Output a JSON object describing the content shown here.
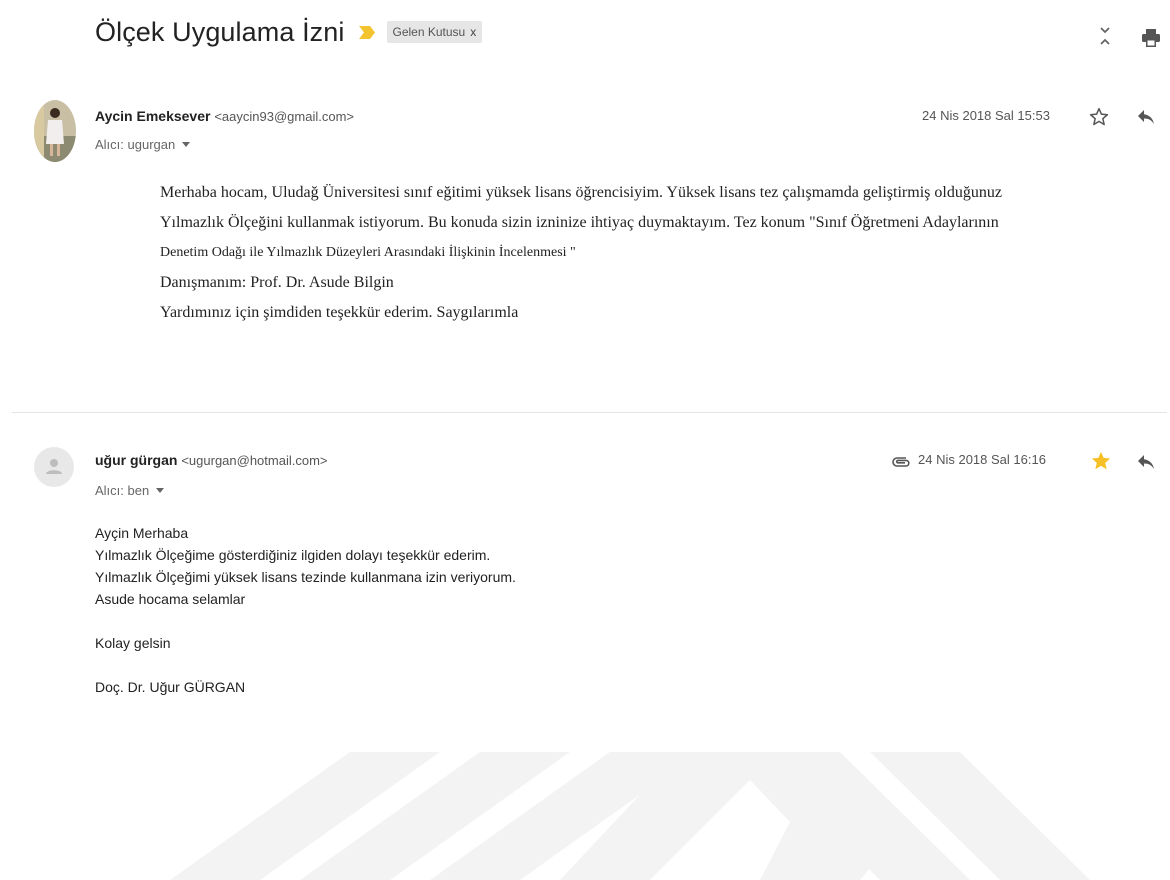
{
  "thread": {
    "subject": "Ölçek Uygulama İzni",
    "label": "Gelen Kutusu",
    "label_close": "x"
  },
  "messages": [
    {
      "sender_name": "Aycin Emeksever",
      "sender_email": "<aaycin93@gmail.com>",
      "to": "Alıcı: ugurgan",
      "date": "24 Nis 2018 Sal 15:53",
      "starred": false,
      "has_attachment": false,
      "body": [
        "Merhaba hocam, Uludağ Üniversitesi sınıf eğitimi yüksek lisans öğrencisiyim. Yüksek lisans tez çalışmamda geliştirmiş olduğunuz",
        "Yılmazlık Ölçeğini  kullanmak istiyorum. Bu konuda sizin izninize ihtiyaç duymaktayım. Tez konum \"Sınıf Öğretmeni Adaylarının",
        "Denetim Odağı ile Yılmazlık Düzeyleri Arasındaki İlişkinin İncelenmesi \"",
        "Danışmanım: Prof. Dr. Asude Bilgin",
        "Yardımınız için şimdiden teşekkür ederim. Saygılarımla"
      ]
    },
    {
      "sender_name": "uğur gürgan",
      "sender_email": "<ugurgan@hotmail.com>",
      "to": "Alıcı: ben",
      "date": "24 Nis 2018 Sal 16:16",
      "starred": true,
      "has_attachment": true,
      "body": [
        "Ayçin Merhaba",
        "Yılmazlık Ölçeğime gösterdiğiniz ilgiden dolayı teşekkür ederim.",
        "Yılmazlık Ölçeğimi yüksek lisans tezinde kullanmana izin veriyorum.",
        "Asude hocama selamlar",
        "",
        "Kolay gelsin",
        "",
        "Doç. Dr. Uğur GÜRGAN"
      ]
    }
  ],
  "icons": {
    "importance": "importance-marker-icon",
    "expand_collapse": "expand-collapse-icon",
    "print": "print-icon",
    "star_empty": "star-outline-icon",
    "star_filled": "star-filled-icon",
    "reply": "reply-icon",
    "attachment": "attachment-icon",
    "avatar_placeholder": "person-icon"
  },
  "colors": {
    "importance": "#f4c430",
    "star": "#f6c026",
    "label_bg": "#e6e6e6",
    "watermark": "#f3f3f3"
  }
}
